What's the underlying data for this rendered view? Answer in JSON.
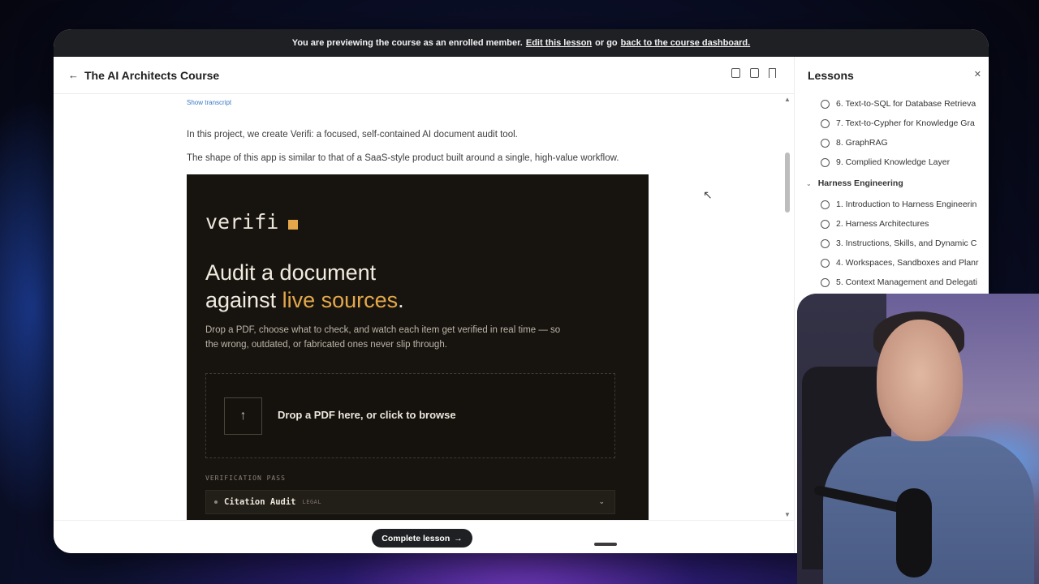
{
  "banner": {
    "prefix": "You are previewing the course as an enrolled member.",
    "edit_link": "Edit this lesson",
    "middle": "or go",
    "dashboard_link": "back to the course dashboard."
  },
  "header": {
    "back_icon": "←",
    "course_title": "The AI Architects Course"
  },
  "content": {
    "show_transcript": "Show transcript",
    "paragraph1": "In this project, we create Verifi: a focused, self-contained AI document audit tool.",
    "paragraph2": "The shape of this app is similar to that of a SaaS-style product built around a single, high-value workflow."
  },
  "hero": {
    "logo": "verifi",
    "heading_line1": "Audit a document",
    "heading_line2_start": "against ",
    "heading_accent": "live sources",
    "heading_end": ".",
    "subtext": "Drop a PDF, choose what to check, and watch each item get verified in real time — so the wrong, outdated, or fabricated ones never slip through.",
    "drop_icon": "↑",
    "drop_text": "Drop a PDF here, or click to browse",
    "verification_label": "VERIFICATION PASS",
    "selected_pass": "Citation Audit",
    "selected_tag": "LEGAL",
    "accent_color": "#e4a84b"
  },
  "footer": {
    "complete_label": "Complete lesson",
    "complete_arrow": "→"
  },
  "sidebar": {
    "title": "Lessons",
    "close_icon": "✕",
    "lessons_top": [
      "6. Text-to-SQL for Database Retrieva",
      "7. Text-to-Cypher for Knowledge Gra",
      "8. GraphRAG",
      "9. Complied Knowledge Layer"
    ],
    "section": "Harness Engineering",
    "lessons_section": [
      "1. Introduction to Harness Engineerin",
      "2. Harness Architectures",
      "3. Instructions, Skills, and Dynamic C",
      "4. Workspaces, Sandboxes and Planr",
      "5. Context Management and Delegati"
    ]
  }
}
